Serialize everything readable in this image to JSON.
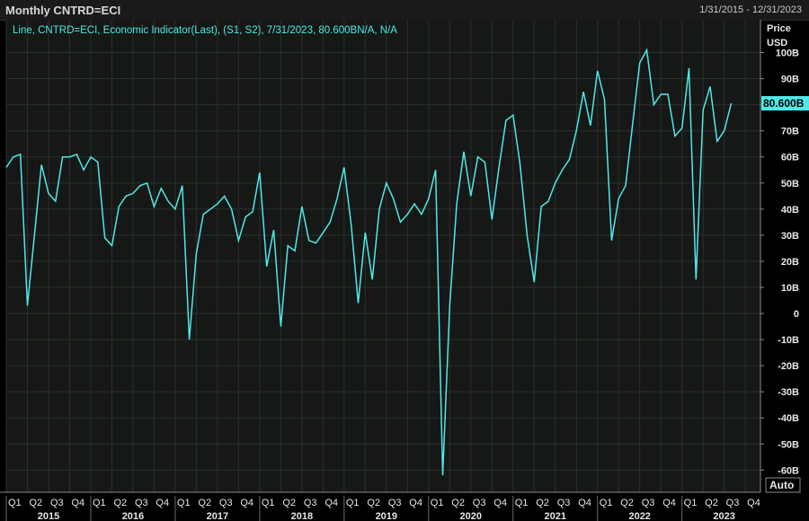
{
  "header": {
    "title": "Monthly CNTRD=ECI",
    "date_range": "1/31/2015 - 12/31/2023"
  },
  "legend": {
    "text": "Line, CNTRD=ECI, Economic Indicator(Last), (S1, S2), 7/31/2023, 80.600BN/A, N/A"
  },
  "y_axis": {
    "title_line1": "Price",
    "title_line2": "USD",
    "last_value_label": "80.600B"
  },
  "auto_button": "Auto",
  "colors": {
    "line": "#4fe8e8",
    "plot_background": "#151815",
    "grid": "#2c302c",
    "last_value_bg": "#4fe8e8"
  },
  "chart_data": {
    "type": "line",
    "title": "Monthly CNTRD=ECI",
    "xlabel": "",
    "ylabel": "Price USD",
    "ylim": [
      -65,
      105
    ],
    "yticks": [
      100,
      90,
      80,
      70,
      60,
      50,
      40,
      30,
      20,
      10,
      0,
      -10,
      -20,
      -30,
      -40,
      -50,
      -60
    ],
    "ytick_labels": [
      "100B",
      "90B",
      "80B",
      "70B",
      "60B",
      "50B",
      "40B",
      "30B",
      "20B",
      "10B",
      "0",
      "-10B",
      "-20B",
      "-30B",
      "-40B",
      "-50B",
      "-60B"
    ],
    "years": [
      "2015",
      "2016",
      "2017",
      "2018",
      "2019",
      "2020",
      "2021",
      "2022",
      "2023"
    ],
    "quarters": [
      "Q1",
      "Q2",
      "Q3",
      "Q4"
    ],
    "x_start": "2015-01",
    "series": [
      {
        "name": "CNTRD=ECI",
        "values": [
          56,
          60,
          61,
          3,
          30,
          57,
          46,
          43,
          60,
          60,
          61,
          55,
          60,
          58,
          29,
          26,
          41,
          45,
          46,
          49,
          50,
          41,
          48,
          43,
          40,
          49,
          -10,
          23,
          38,
          40,
          42,
          45,
          40,
          28,
          37,
          39,
          54,
          18,
          32,
          -5,
          26,
          24,
          41,
          28,
          27,
          31,
          35,
          44,
          56,
          34,
          4,
          31,
          13,
          40,
          50,
          44,
          35,
          38,
          42,
          38,
          44,
          55,
          -62,
          3,
          42,
          62,
          45,
          60,
          58,
          36,
          56,
          74,
          76,
          57,
          30,
          12,
          41,
          43,
          50,
          55,
          59,
          70,
          85,
          72,
          93,
          82,
          28,
          44,
          49,
          73,
          96,
          101,
          80,
          84,
          84,
          68,
          71,
          94,
          13,
          78,
          87,
          66,
          70,
          80.6
        ]
      }
    ],
    "last_value": 80.6,
    "last_date": "7/31/2023",
    "grid": true
  }
}
